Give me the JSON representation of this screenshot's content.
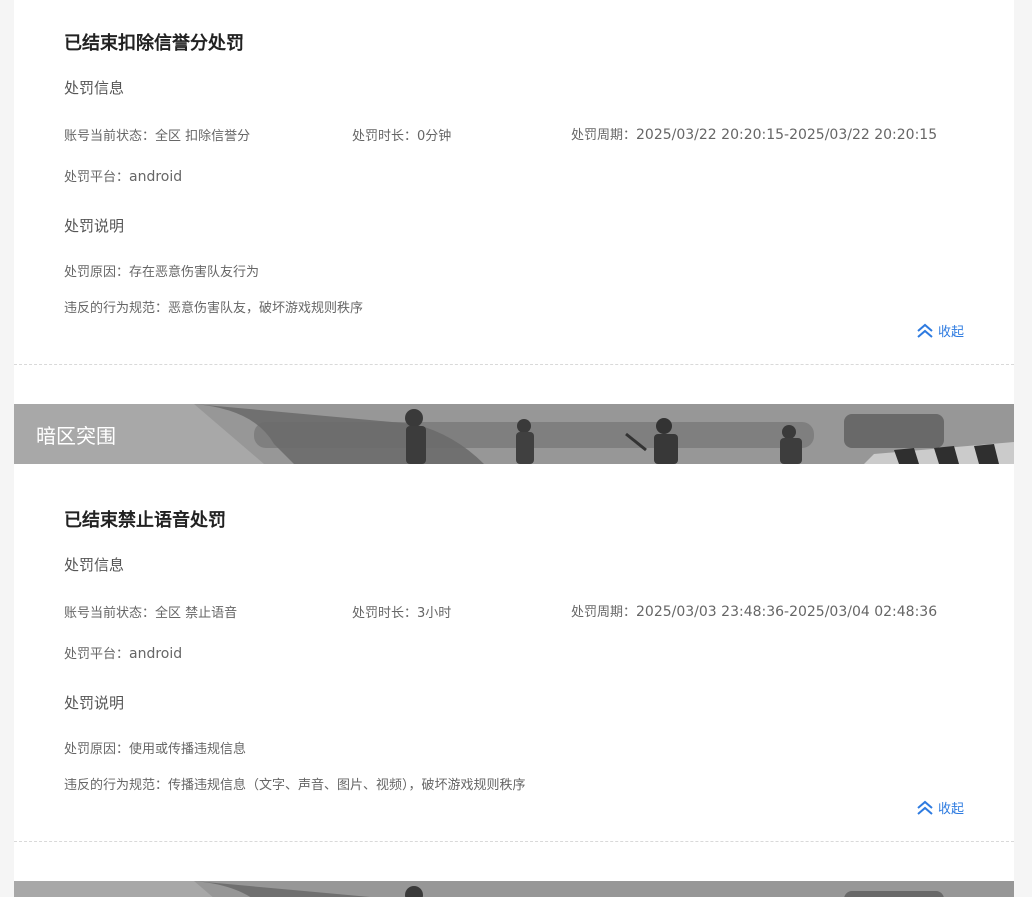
{
  "collapse_label": "收起",
  "records": [
    {
      "title": "已结束扣除信誉分处罚",
      "info_heading": "处罚信息",
      "status_label": "账号当前状态：",
      "status_value": "全区 扣除信誉分",
      "duration_label": "处罚时长：",
      "duration_value": "0分钟",
      "period_label": "处罚周期：",
      "period_value": "2025/03/22 20:20:15-2025/03/22 20:20:15",
      "platform_label": "处罚平台：",
      "platform_value": "android",
      "desc_heading": "处罚说明",
      "reason_label": "处罚原因：",
      "reason_value": "存在恶意伤害队友行为",
      "rule_label": "违反的行为规范：",
      "rule_value": "恶意伤害队友，破坏游戏规则秩序"
    },
    {
      "title": "已结束禁止语音处罚",
      "info_heading": "处罚信息",
      "status_label": "账号当前状态：",
      "status_value": "全区 禁止语音",
      "duration_label": "处罚时长：",
      "duration_value": "3小时",
      "period_label": "处罚周期：",
      "period_value": "2025/03/03 23:48:36-2025/03/04 02:48:36",
      "platform_label": "处罚平台：",
      "platform_value": "android",
      "desc_heading": "处罚说明",
      "reason_label": "处罚原因：",
      "reason_value": "使用或传播违规信息",
      "rule_label": "违反的行为规范：",
      "rule_value": "传播违规信息（文字、声音、图片、视频），破坏游戏规则秩序"
    }
  ],
  "game_banner": {
    "title": "暗区突围"
  },
  "colors": {
    "accent": "#2e7be0",
    "title": "#222222",
    "text": "#666666",
    "background": "#f5f5f5"
  }
}
